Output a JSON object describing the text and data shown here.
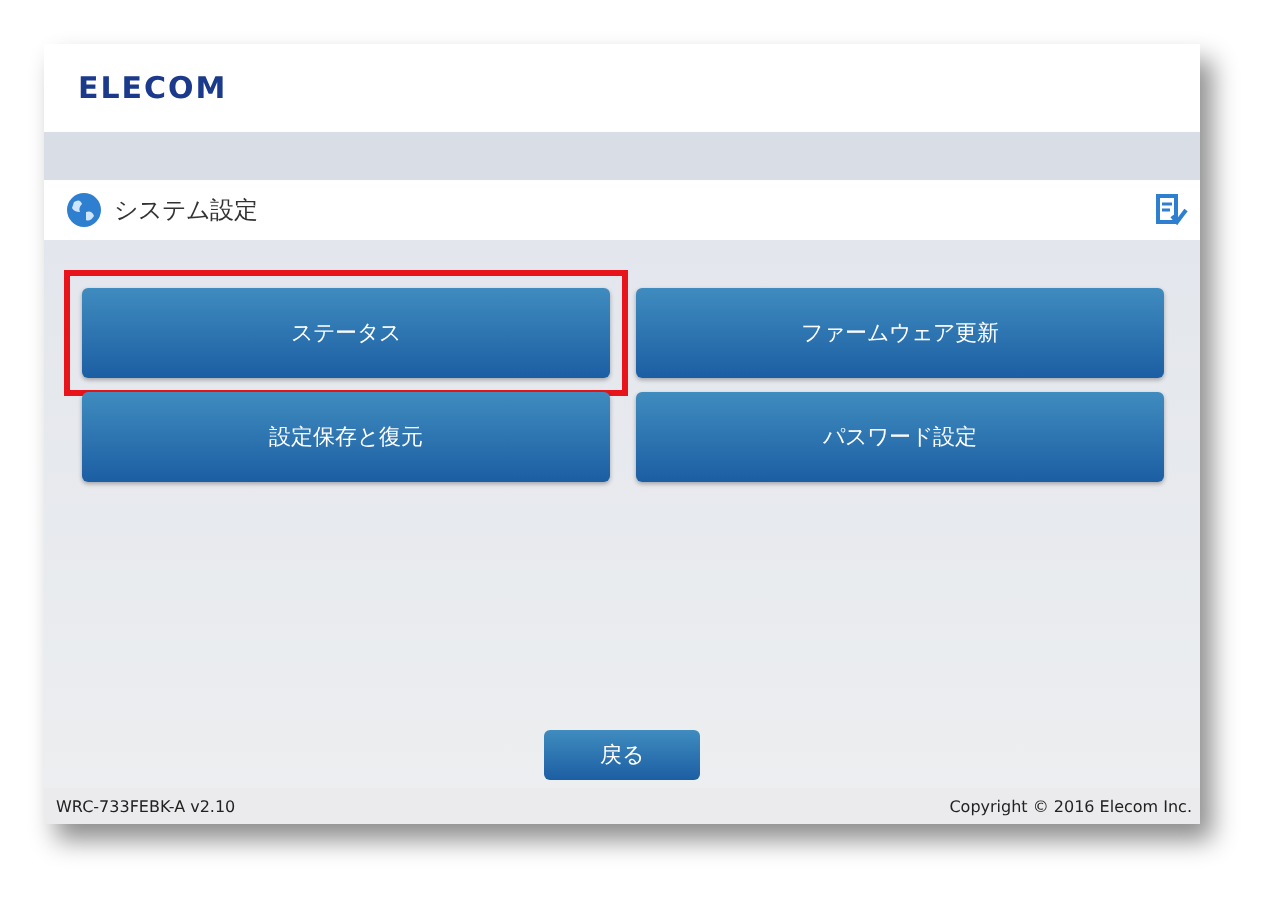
{
  "header": {
    "logo": "ELECOM"
  },
  "section": {
    "title": "システム設定"
  },
  "buttons": [
    {
      "label": "ステータス",
      "highlighted": true
    },
    {
      "label": "ファームウェア更新",
      "highlighted": false
    },
    {
      "label": "設定保存と復元",
      "highlighted": false
    },
    {
      "label": "パスワード設定",
      "highlighted": false
    }
  ],
  "back_button": "戻る",
  "footer": {
    "version": "WRC-733FEBK-A v2.10",
    "copyright": "Copyright © 2016 Elecom Inc."
  }
}
